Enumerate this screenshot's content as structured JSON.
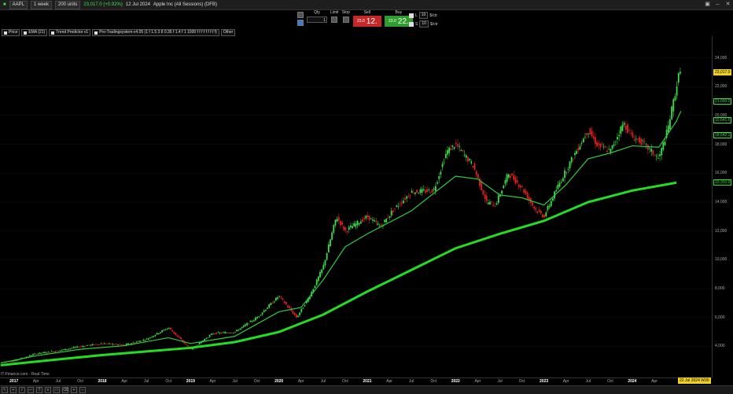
{
  "topbar": {
    "symbol": "AAPL",
    "period": "1 week",
    "units": "200 units",
    "price": "23,017.0 (+0.92%)",
    "date": "12 Jul 2024",
    "instrument": "Apple Inc (All Sessions) (DFB)"
  },
  "order": {
    "qty_label": "Qty",
    "qty_value": "1",
    "limit_label": "Limit",
    "stop_label": "Stop",
    "sell_label": "Sell",
    "sell_small": "23.0",
    "sell_big": "12.",
    "buy_label": "Buy",
    "buy_small": "23.0",
    "buy_big": "22.",
    "l_label": "L",
    "l_value": "10",
    "s_label": "S",
    "s_value": "10",
    "unit": "$/ctr"
  },
  "legend": [
    "Price",
    "EMA (21)",
    "Trend Predictor v1",
    "Pro-Tradingsystem-v4.05 (1 f 1.5 3 8 0.35 f 1.4 f 1 1000 f f f f f f f f f)",
    "Other"
  ],
  "footer": "IT-Finance.com - Real-Time",
  "date_badge": "22 Jul 2024 W30",
  "colors": {
    "background": "#000000",
    "bull": "#3ddc4a",
    "bear": "#e02020",
    "ema_long": "#22dd22",
    "price_tag": "#f0d020"
  },
  "chart_data": {
    "type": "line",
    "title": "",
    "ylim": [
      2500,
      25500
    ],
    "y_ticks": [
      4000,
      6000,
      8000,
      10000,
      12000,
      14000,
      16000,
      18000,
      20000,
      22000,
      24000
    ],
    "y_tick_labels": [
      "4,000",
      "6,000",
      "8,000",
      "10,000",
      "12,000",
      "14,000",
      "16,000",
      "18,000",
      "20,000",
      "22,000",
      "24,000"
    ],
    "x_labels": [
      {
        "t": 2017.0,
        "label": "2017",
        "year": true
      },
      {
        "t": 2017.25,
        "label": "Apr"
      },
      {
        "t": 2017.5,
        "label": "Jul"
      },
      {
        "t": 2017.75,
        "label": "Oct"
      },
      {
        "t": 2018.0,
        "label": "2018",
        "year": true
      },
      {
        "t": 2018.25,
        "label": "Apr"
      },
      {
        "t": 2018.5,
        "label": "Jul"
      },
      {
        "t": 2018.75,
        "label": "Oct"
      },
      {
        "t": 2019.0,
        "label": "2019",
        "year": true
      },
      {
        "t": 2019.25,
        "label": "Apr"
      },
      {
        "t": 2019.5,
        "label": "Jul"
      },
      {
        "t": 2019.75,
        "label": "Oct"
      },
      {
        "t": 2020.0,
        "label": "2020",
        "year": true
      },
      {
        "t": 2020.25,
        "label": "Apr"
      },
      {
        "t": 2020.5,
        "label": "Jul"
      },
      {
        "t": 2020.75,
        "label": "Oct"
      },
      {
        "t": 2021.0,
        "label": "2021",
        "year": true
      },
      {
        "t": 2021.25,
        "label": "Apr"
      },
      {
        "t": 2021.5,
        "label": "Jul"
      },
      {
        "t": 2021.75,
        "label": "Oct"
      },
      {
        "t": 2022.0,
        "label": "2022",
        "year": true
      },
      {
        "t": 2022.25,
        "label": "Apr"
      },
      {
        "t": 2022.5,
        "label": "Jul"
      },
      {
        "t": 2022.75,
        "label": "Oct"
      },
      {
        "t": 2023.0,
        "label": "2023",
        "year": true
      },
      {
        "t": 2023.25,
        "label": "Apr"
      },
      {
        "t": 2023.5,
        "label": "Jul"
      },
      {
        "t": 2023.75,
        "label": "Oct"
      },
      {
        "t": 2024.0,
        "label": "2024",
        "year": true
      },
      {
        "t": 2024.25,
        "label": "Apr"
      }
    ],
    "price_tags": [
      {
        "value": 23017,
        "label": "23,017.0",
        "color": "#f0d020"
      },
      {
        "value": 21000,
        "label": "21,000.0",
        "color": "#3ddc4a"
      },
      {
        "value": 19641.5,
        "label": "19,641.5",
        "color": "#3ddc4a"
      },
      {
        "value": 18642.1,
        "label": "18,642.1",
        "color": "#3ddc4a"
      },
      {
        "value": 15350.9,
        "label": "15,350.9",
        "color": "#22dd22"
      }
    ],
    "series": [
      {
        "color": "#3ddc4a",
        "points": [
          [
            2016.85,
            2900
          ],
          [
            2017.0,
            3000
          ],
          [
            2017.25,
            3500
          ],
          [
            2017.5,
            3700
          ],
          [
            2017.75,
            4000
          ],
          [
            2018.0,
            4200
          ],
          [
            2018.25,
            4100
          ],
          [
            2018.5,
            4500
          ],
          [
            2018.75,
            5300
          ],
          [
            2019.0,
            3800
          ],
          [
            2019.25,
            4900
          ],
          [
            2019.5,
            5000
          ],
          [
            2019.75,
            6000
          ],
          [
            2020.0,
            7500
          ],
          [
            2020.2,
            6000
          ],
          [
            2020.35,
            7500
          ],
          [
            2020.5,
            9500
          ],
          [
            2020.65,
            13000
          ],
          [
            2020.75,
            12000
          ],
          [
            2021.0,
            13000
          ],
          [
            2021.15,
            12300
          ],
          [
            2021.3,
            13500
          ],
          [
            2021.5,
            14700
          ],
          [
            2021.75,
            14800
          ],
          [
            2021.9,
            17500
          ],
          [
            2022.0,
            18000
          ],
          [
            2022.2,
            16500
          ],
          [
            2022.35,
            14000
          ],
          [
            2022.45,
            13800
          ],
          [
            2022.6,
            16000
          ],
          [
            2022.75,
            15000
          ],
          [
            2022.9,
            13500
          ],
          [
            2023.0,
            13000
          ],
          [
            2023.15,
            15000
          ],
          [
            2023.3,
            16800
          ],
          [
            2023.5,
            19000
          ],
          [
            2023.6,
            18000
          ],
          [
            2023.75,
            17500
          ],
          [
            2023.9,
            19500
          ],
          [
            2024.0,
            18500
          ],
          [
            2024.1,
            18200
          ],
          [
            2024.3,
            17000
          ],
          [
            2024.4,
            19000
          ],
          [
            2024.5,
            22000
          ],
          [
            2024.55,
            23500
          ]
        ]
      },
      {
        "color": "#2ecc40",
        "points": [
          [
            2016.85,
            2850
          ],
          [
            2017.25,
            3350
          ],
          [
            2017.75,
            3800
          ],
          [
            2018.25,
            4050
          ],
          [
            2018.75,
            4600
          ],
          [
            2019.0,
            4200
          ],
          [
            2019.5,
            4700
          ],
          [
            2020.0,
            6400
          ],
          [
            2020.25,
            6700
          ],
          [
            2020.5,
            8600
          ],
          [
            2020.75,
            10900
          ],
          [
            2021.0,
            11800
          ],
          [
            2021.5,
            13400
          ],
          [
            2022.0,
            15800
          ],
          [
            2022.25,
            15600
          ],
          [
            2022.5,
            14500
          ],
          [
            2022.75,
            14300
          ],
          [
            2023.0,
            13800
          ],
          [
            2023.25,
            15200
          ],
          [
            2023.5,
            17000
          ],
          [
            2023.75,
            17400
          ],
          [
            2024.0,
            17900
          ],
          [
            2024.3,
            17800
          ],
          [
            2024.5,
            19600
          ],
          [
            2024.55,
            20300
          ]
        ]
      },
      {
        "color": "#22dd22",
        "points": [
          [
            2016.85,
            2700
          ],
          [
            2017.5,
            3100
          ],
          [
            2018.0,
            3400
          ],
          [
            2018.5,
            3650
          ],
          [
            2019.0,
            3900
          ],
          [
            2019.5,
            4300
          ],
          [
            2020.0,
            5000
          ],
          [
            2020.5,
            6200
          ],
          [
            2021.0,
            7800
          ],
          [
            2021.5,
            9300
          ],
          [
            2022.0,
            10800
          ],
          [
            2022.5,
            11800
          ],
          [
            2023.0,
            12700
          ],
          [
            2023.5,
            14000
          ],
          [
            2024.0,
            14800
          ],
          [
            2024.5,
            15350
          ]
        ]
      }
    ]
  }
}
